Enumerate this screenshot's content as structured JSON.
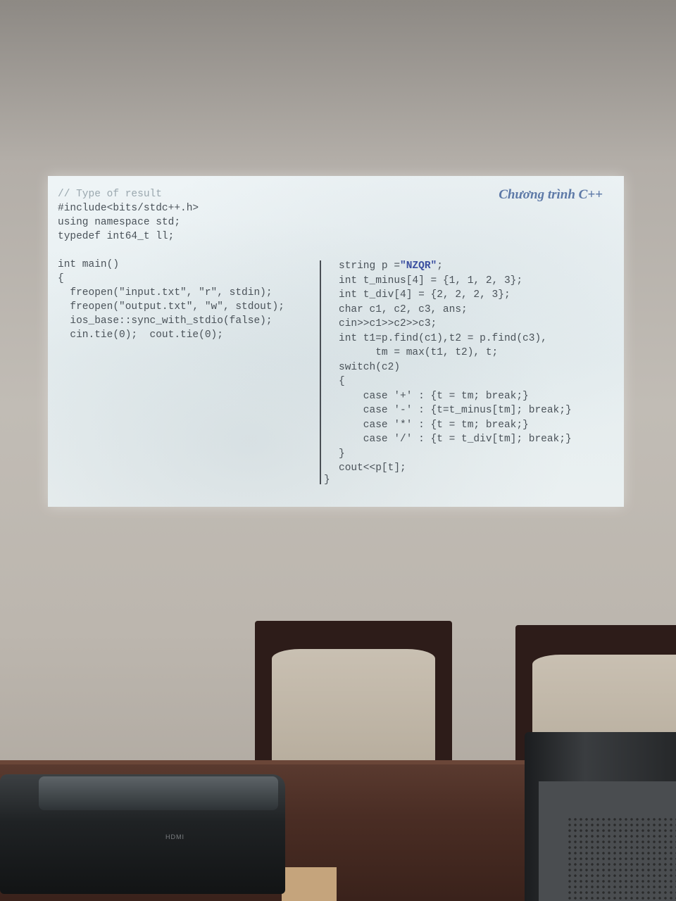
{
  "slide": {
    "title": "Chương trình C++",
    "left_code": {
      "comment": "// Type of result",
      "lines": [
        "#include<bits/stdc++.h>",
        "using namespace std;",
        "typedef int64_t ll;",
        "",
        "int main()",
        "{",
        "  freopen(\"input.txt\", \"r\", stdin);",
        "  freopen(\"output.txt\", \"w\", stdout);",
        "  ios_base::sync_with_stdio(false);",
        "  cin.tie(0);  cout.tie(0);"
      ]
    },
    "right_code": {
      "string_prefix": "string p =",
      "string_literal": "\"NZQR\"",
      "string_suffix": ";",
      "lines": [
        "int t_minus[4] = {1, 1, 2, 3};",
        "int t_div[4] = {2, 2, 2, 3};",
        "char c1, c2, c3, ans;",
        "cin>>c1>>c2>>c3;",
        "int t1=p.find(c1),t2 = p.find(c3),",
        "      tm = max(t1, t2), t;",
        "switch(c2)",
        "{",
        "    case '+' : {t = tm; break;}",
        "    case '-' : {t=t_minus[tm]; break;}",
        "    case '*' : {t = tm; break;}",
        "    case '/' : {t = t_div[tm]; break;}",
        "}",
        "cout<<p[t];"
      ]
    },
    "closing_brace": "}"
  },
  "room": {
    "projector_label": "HDMI"
  }
}
